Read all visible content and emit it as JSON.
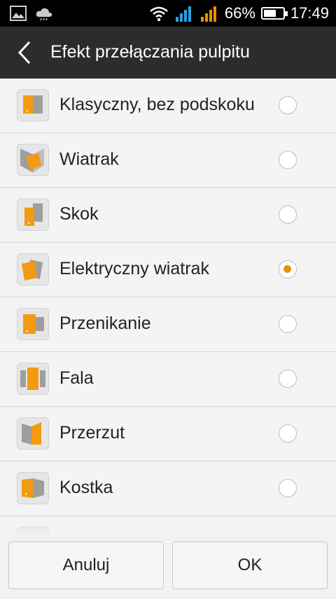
{
  "status_bar": {
    "battery": "66%",
    "time": "17:49",
    "battery_level": 0.66
  },
  "header": {
    "title": "Efekt przełączania pulpitu"
  },
  "options": [
    {
      "label": "Klasyczny, bez podskoku",
      "selected": false,
      "icon": "classic-effect-icon"
    },
    {
      "label": "Wiatrak",
      "selected": false,
      "icon": "windmill-effect-icon"
    },
    {
      "label": "Skok",
      "selected": false,
      "icon": "jump-effect-icon"
    },
    {
      "label": "Elektryczny wiatrak",
      "selected": true,
      "icon": "electric-fan-effect-icon"
    },
    {
      "label": "Przenikanie",
      "selected": false,
      "icon": "crossfade-effect-icon"
    },
    {
      "label": "Fala",
      "selected": false,
      "icon": "wave-effect-icon"
    },
    {
      "label": "Przerzut",
      "selected": false,
      "icon": "flip-effect-icon"
    },
    {
      "label": "Kostka",
      "selected": false,
      "icon": "cube-effect-icon"
    }
  ],
  "buttons": {
    "cancel": "Anuluj",
    "ok": "OK"
  },
  "colors": {
    "accent": "#f08c00",
    "titlebar": "#2c2c2c",
    "statusbar": "#000000"
  }
}
